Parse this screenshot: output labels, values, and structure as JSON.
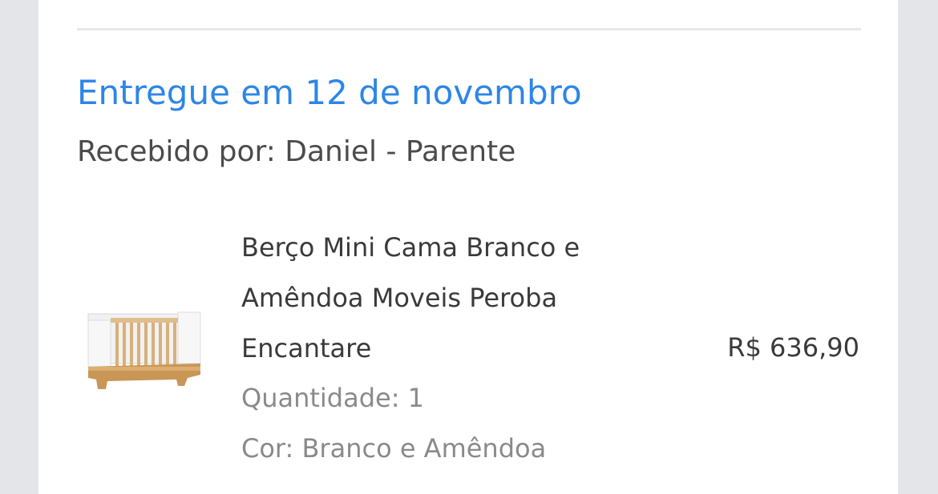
{
  "delivery": {
    "title": "Entregue em 12 de novembro",
    "received_by": "Recebido por: Daniel - Parente"
  },
  "product": {
    "title_lines": [
      "Berço Mini Cama Branco e",
      "Amêndoa Moveis Peroba",
      "Encantare"
    ],
    "quantity": "Quantidade: 1",
    "color": "Cor: Branco e Amêndoa",
    "price": "R$ 636,90",
    "image_icon": "crib-product-image"
  },
  "colors": {
    "accent": "#2d86e6",
    "background": "#e3e5e8",
    "card": "#ffffff"
  }
}
